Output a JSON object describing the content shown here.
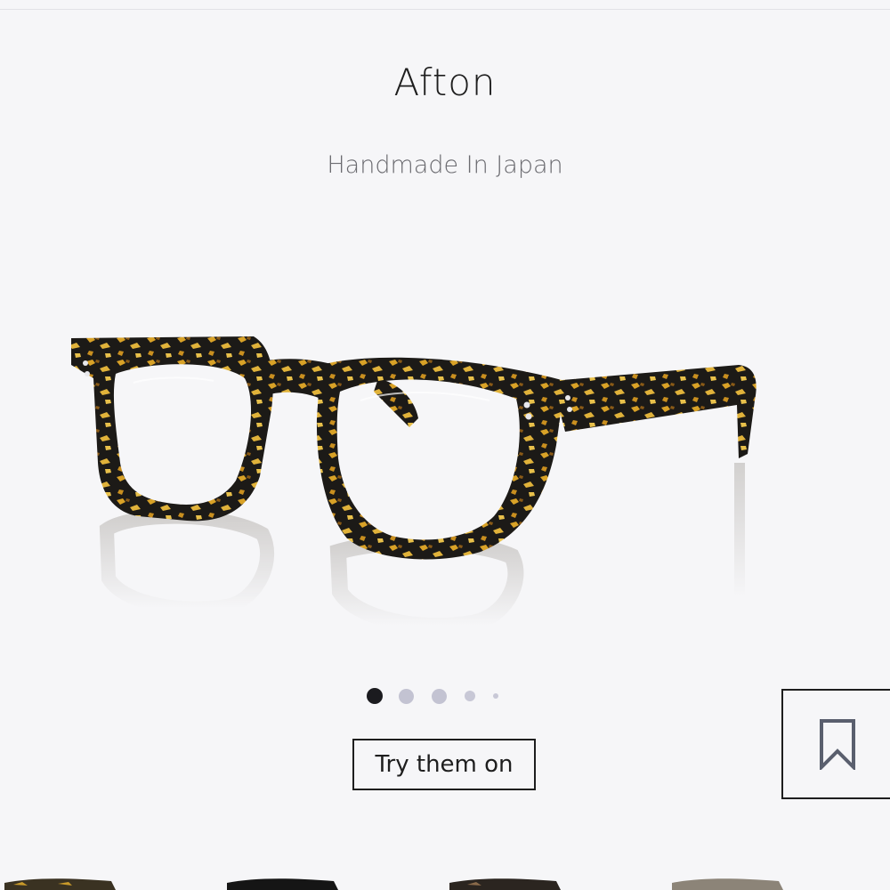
{
  "product": {
    "name": "Afton",
    "tagline": "Handmade In Japan",
    "image_alt_icon": "eyeglasses-tortoise-frame"
  },
  "carousel": {
    "total_slides": 5,
    "active_index": 0
  },
  "actions": {
    "try_on_label": "Try them on",
    "bookmark_icon": "bookmark-icon"
  },
  "colors": {
    "background": "#f6f6f8",
    "text": "#1e1e1e",
    "subtitle": "#6b6b70",
    "dot_active": "#1b1b1f",
    "dot_inactive": "#c3c3d2",
    "tortoise_dark": "#1c1a17",
    "tortoise_amber": "#d9a227"
  }
}
